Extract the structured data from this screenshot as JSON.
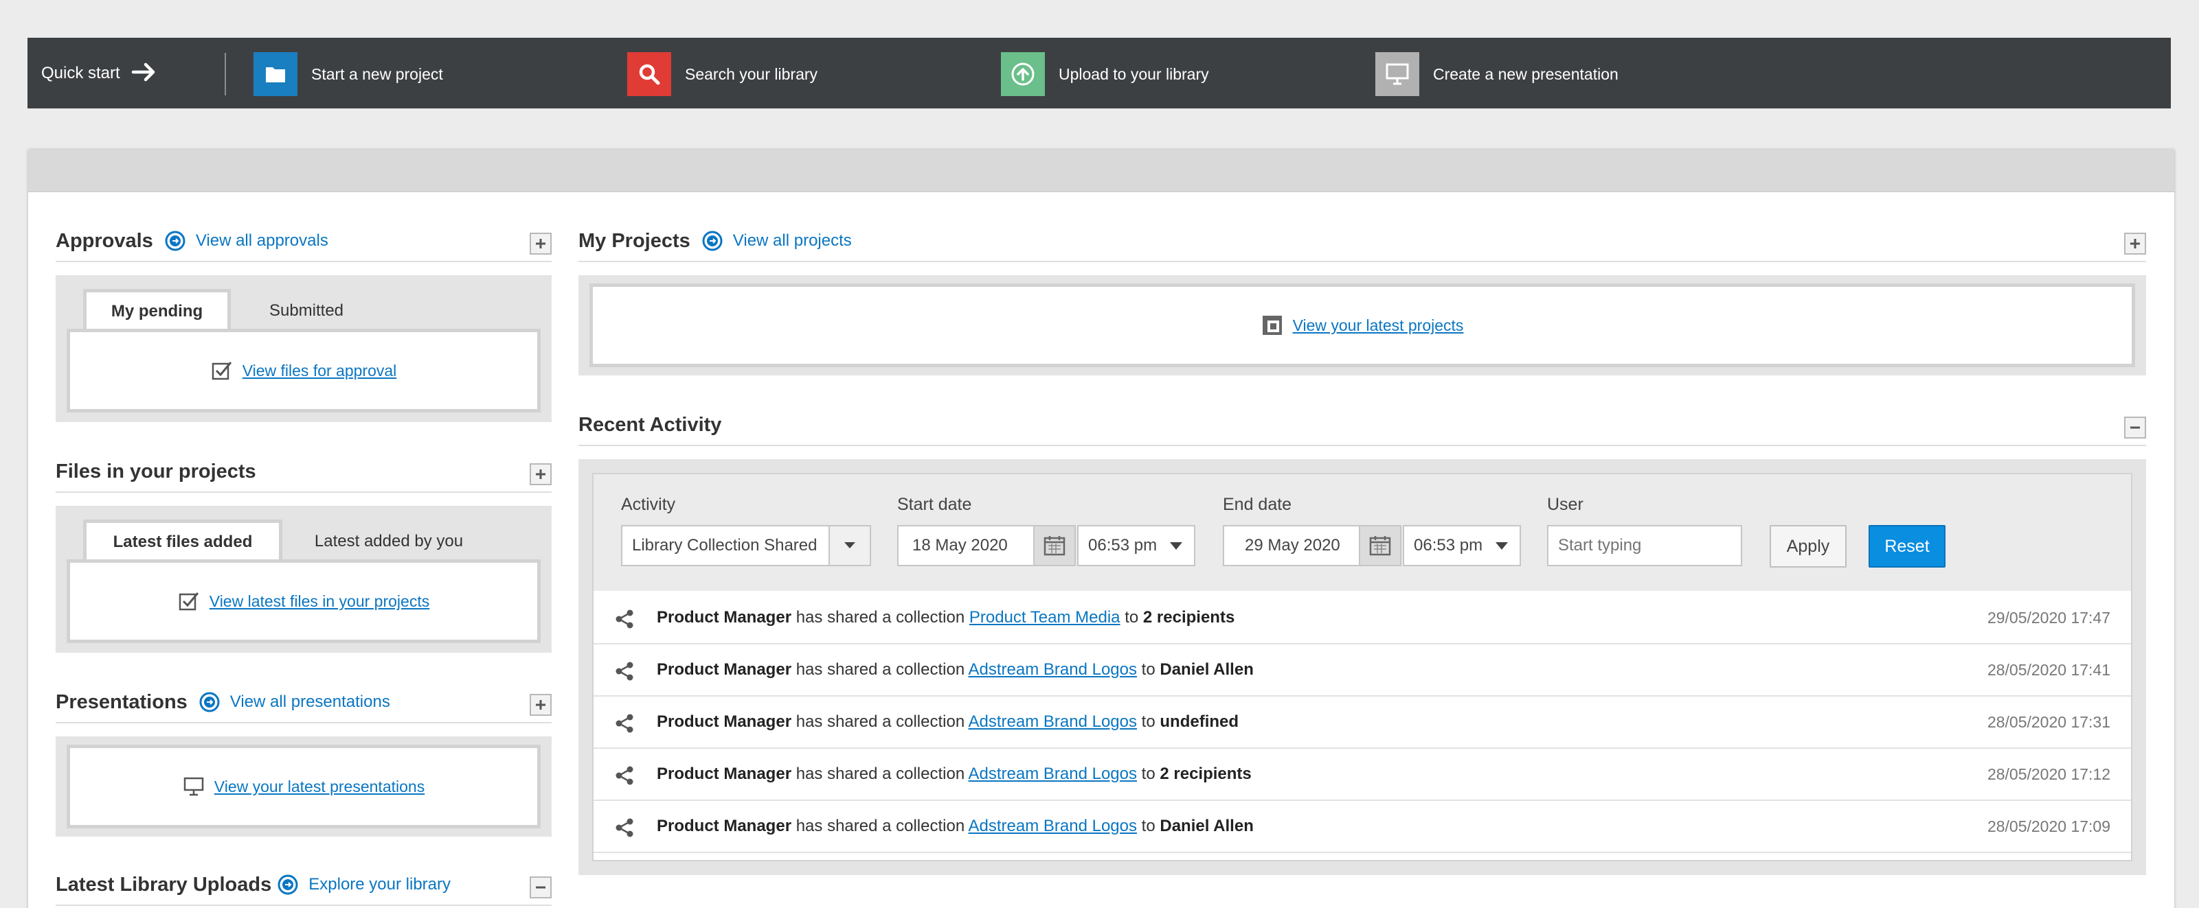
{
  "quick_start": {
    "title": "Quick start",
    "items": [
      {
        "label": "Start a new project",
        "color": "#1a7fc0",
        "icon": "folder-icon"
      },
      {
        "label": "Search your library",
        "color": "#e03b34",
        "icon": "search-icon"
      },
      {
        "label": "Upload to your library",
        "color": "#6bbf8a",
        "icon": "upload-icon"
      },
      {
        "label": "Create a new presentation",
        "color": "#b1b1b1",
        "icon": "presentation-icon"
      }
    ]
  },
  "approvals": {
    "title": "Approvals",
    "link": "View all approvals",
    "tabs": [
      "My pending",
      "Submitted"
    ],
    "body_link": "View files for approval"
  },
  "files_in_projects": {
    "title": "Files in your projects",
    "tabs": [
      "Latest files added",
      "Latest added by you"
    ],
    "body_link": "View latest files in your projects"
  },
  "presentations": {
    "title": "Presentations",
    "link": "View all presentations",
    "body_link": "View your latest presentations"
  },
  "library_uploads": {
    "title": "Latest Library Uploads",
    "link": "Explore your library"
  },
  "my_projects": {
    "title": "My Projects",
    "link": "View all projects",
    "body_link": "View your latest projects"
  },
  "recent_activity": {
    "title": "Recent Activity",
    "filters": {
      "activity_label": "Activity",
      "activity_value": "Library Collection Shared",
      "start_label": "Start date",
      "start_date": "18 May 2020",
      "start_time": "06:53 pm",
      "end_label": "End date",
      "end_date": "29 May 2020",
      "end_time": "06:53 pm",
      "user_label": "User",
      "user_placeholder": "Start typing",
      "apply": "Apply",
      "reset": "Reset"
    },
    "rows": [
      {
        "actor": "Product Manager",
        "action": " has shared a collection ",
        "collection": "Product Team Media",
        "to": " to ",
        "target": "2 recipients",
        "time": "29/05/2020 17:47"
      },
      {
        "actor": "Product Manager",
        "action": " has shared a collection ",
        "collection": "Adstream Brand Logos",
        "to": " to ",
        "target": "Daniel Allen",
        "time": "28/05/2020 17:41"
      },
      {
        "actor": "Product Manager",
        "action": " has shared a collection ",
        "collection": "Adstream Brand Logos",
        "to": " to ",
        "target": "undefined",
        "time": "28/05/2020 17:31"
      },
      {
        "actor": "Product Manager",
        "action": " has shared a collection ",
        "collection": "Adstream Brand Logos",
        "to": " to ",
        "target": "2 recipients",
        "time": "28/05/2020 17:12"
      },
      {
        "actor": "Product Manager",
        "action": " has shared a collection ",
        "collection": "Adstream Brand Logos",
        "to": " to ",
        "target": "Daniel Allen",
        "time": "28/05/2020 17:09"
      }
    ]
  }
}
